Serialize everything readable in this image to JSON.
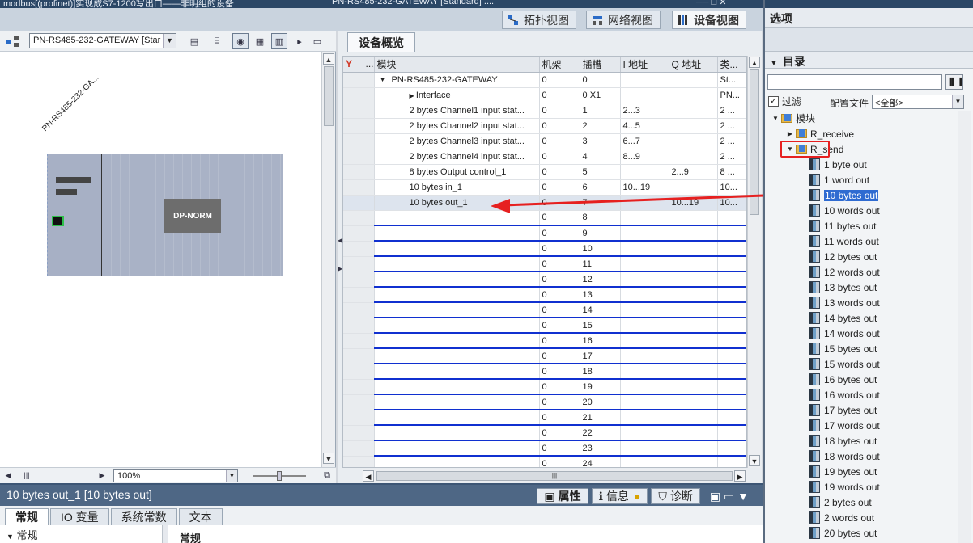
{
  "window": {
    "title_left": "modbus[(profinet)]实现成S7-1200写出口——非明组的设备",
    "title_mid": "PN-RS485-232-GATEWAY [Standard] ....",
    "title_right": "── □ ✕"
  },
  "view_tabs": [
    {
      "label": "拓扑视图",
      "icon": "topology-icon"
    },
    {
      "label": "网络视图",
      "icon": "network-icon"
    },
    {
      "label": "设备视图",
      "icon": "device-icon"
    }
  ],
  "device_toolbar": {
    "device_select": "PN-RS485-232-GATEWAY [Star",
    "zoom": "100%"
  },
  "device_graphic": {
    "device_label": "PN-RS485-232-GA...",
    "module_label": "DP-NORM"
  },
  "overview": {
    "tab": "设备概览",
    "headers": [
      "",
      "...",
      "模块",
      "机架",
      "插槽",
      "I 地址",
      "Q 地址",
      "类..."
    ],
    "rows": [
      {
        "module": "PN-RS485-232-GATEWAY",
        "rack": "0",
        "slot": "0",
        "i": "",
        "q": "",
        "type": "St...",
        "indent": 1,
        "expand": "▼"
      },
      {
        "module": "Interface",
        "rack": "0",
        "slot": "0 X1",
        "i": "",
        "q": "",
        "type": "PN...",
        "indent": 2,
        "expand": "▶"
      },
      {
        "module": "2 bytes Channel1 input stat...",
        "rack": "0",
        "slot": "1",
        "i": "2...3",
        "q": "",
        "type": "2 ...",
        "indent": 2,
        "expand": ""
      },
      {
        "module": "2 bytes Channel2 input stat...",
        "rack": "0",
        "slot": "2",
        "i": "4...5",
        "q": "",
        "type": "2 ...",
        "indent": 2,
        "expand": ""
      },
      {
        "module": "2 bytes Channel3 input stat...",
        "rack": "0",
        "slot": "3",
        "i": "6...7",
        "q": "",
        "type": "2 ...",
        "indent": 2,
        "expand": ""
      },
      {
        "module": "2 bytes Channel4 input stat...",
        "rack": "0",
        "slot": "4",
        "i": "8...9",
        "q": "",
        "type": "2 ...",
        "indent": 2,
        "expand": ""
      },
      {
        "module": "8 bytes Output control_1",
        "rack": "0",
        "slot": "5",
        "i": "",
        "q": "2...9",
        "type": "8 ...",
        "indent": 2,
        "expand": ""
      },
      {
        "module": "10 bytes in_1",
        "rack": "0",
        "slot": "6",
        "i": "10...19",
        "q": "",
        "type": "10...",
        "indent": 2,
        "expand": ""
      },
      {
        "module": "10 bytes out_1",
        "rack": "0",
        "slot": "7",
        "i": "",
        "q": "10...19",
        "type": "10...",
        "indent": 2,
        "expand": "",
        "selected": true
      },
      {
        "module": "",
        "rack": "0",
        "slot": "8",
        "i": "",
        "q": "",
        "type": "",
        "empty": true
      },
      {
        "module": "",
        "rack": "0",
        "slot": "9",
        "i": "",
        "q": "",
        "type": "",
        "empty": true
      },
      {
        "module": "",
        "rack": "0",
        "slot": "10",
        "i": "",
        "q": "",
        "type": "",
        "empty": true
      },
      {
        "module": "",
        "rack": "0",
        "slot": "11",
        "i": "",
        "q": "",
        "type": "",
        "empty": true
      },
      {
        "module": "",
        "rack": "0",
        "slot": "12",
        "i": "",
        "q": "",
        "type": "",
        "empty": true
      },
      {
        "module": "",
        "rack": "0",
        "slot": "13",
        "i": "",
        "q": "",
        "type": "",
        "empty": true
      },
      {
        "module": "",
        "rack": "0",
        "slot": "14",
        "i": "",
        "q": "",
        "type": "",
        "empty": true
      },
      {
        "module": "",
        "rack": "0",
        "slot": "15",
        "i": "",
        "q": "",
        "type": "",
        "empty": true
      },
      {
        "module": "",
        "rack": "0",
        "slot": "16",
        "i": "",
        "q": "",
        "type": "",
        "empty": true
      },
      {
        "module": "",
        "rack": "0",
        "slot": "17",
        "i": "",
        "q": "",
        "type": "",
        "empty": true
      },
      {
        "module": "",
        "rack": "0",
        "slot": "18",
        "i": "",
        "q": "",
        "type": "",
        "empty": true
      },
      {
        "module": "",
        "rack": "0",
        "slot": "19",
        "i": "",
        "q": "",
        "type": "",
        "empty": true
      },
      {
        "module": "",
        "rack": "0",
        "slot": "20",
        "i": "",
        "q": "",
        "type": "",
        "empty": true
      },
      {
        "module": "",
        "rack": "0",
        "slot": "21",
        "i": "",
        "q": "",
        "type": "",
        "empty": true
      },
      {
        "module": "",
        "rack": "0",
        "slot": "22",
        "i": "",
        "q": "",
        "type": "",
        "empty": true
      },
      {
        "module": "",
        "rack": "0",
        "slot": "23",
        "i": "",
        "q": "",
        "type": "",
        "empty": true
      },
      {
        "module": "",
        "rack": "0",
        "slot": "24",
        "i": "",
        "q": "",
        "type": "",
        "empty": true
      }
    ]
  },
  "right_panel": {
    "options_title": "选项",
    "catalog_title": "目录",
    "search_placeholder": "",
    "filter_label": "过滤",
    "profile_label": "配置文件",
    "profile_value": "<全部>",
    "tree": [
      {
        "label": "模块",
        "level": 0,
        "type": "folder",
        "expand": "▼"
      },
      {
        "label": "R_receive",
        "level": 1,
        "type": "folder",
        "expand": "▶"
      },
      {
        "label": "R_send",
        "level": 1,
        "type": "folder",
        "expand": "▼"
      },
      {
        "label": "1 byte out",
        "level": 2,
        "type": "module"
      },
      {
        "label": "1 word out",
        "level": 2,
        "type": "module"
      },
      {
        "label": "10 bytes out",
        "level": 2,
        "type": "module",
        "selected": true
      },
      {
        "label": "10 words out",
        "level": 2,
        "type": "module"
      },
      {
        "label": "11 bytes out",
        "level": 2,
        "type": "module"
      },
      {
        "label": "11 words out",
        "level": 2,
        "type": "module"
      },
      {
        "label": "12 bytes out",
        "level": 2,
        "type": "module"
      },
      {
        "label": "12 words out",
        "level": 2,
        "type": "module"
      },
      {
        "label": "13 bytes out",
        "level": 2,
        "type": "module"
      },
      {
        "label": "13 words out",
        "level": 2,
        "type": "module"
      },
      {
        "label": "14 bytes out",
        "level": 2,
        "type": "module"
      },
      {
        "label": "14 words out",
        "level": 2,
        "type": "module"
      },
      {
        "label": "15 bytes out",
        "level": 2,
        "type": "module"
      },
      {
        "label": "15 words out",
        "level": 2,
        "type": "module"
      },
      {
        "label": "16 bytes out",
        "level": 2,
        "type": "module"
      },
      {
        "label": "16 words out",
        "level": 2,
        "type": "module"
      },
      {
        "label": "17 bytes out",
        "level": 2,
        "type": "module"
      },
      {
        "label": "17 words out",
        "level": 2,
        "type": "module"
      },
      {
        "label": "18 bytes out",
        "level": 2,
        "type": "module"
      },
      {
        "label": "18 words out",
        "level": 2,
        "type": "module"
      },
      {
        "label": "19 bytes out",
        "level": 2,
        "type": "module"
      },
      {
        "label": "19 words out",
        "level": 2,
        "type": "module"
      },
      {
        "label": "2 bytes out",
        "level": 2,
        "type": "module"
      },
      {
        "label": "2 words out",
        "level": 2,
        "type": "module"
      },
      {
        "label": "20 bytes out",
        "level": 2,
        "type": "module"
      }
    ]
  },
  "inspector": {
    "title": "10 bytes out_1 [10 bytes out]",
    "right_tabs": [
      "属性",
      "信息",
      "诊断"
    ],
    "sub_tabs": [
      "常规",
      "IO 变量",
      "系统常数",
      "文本"
    ],
    "nav_item": "常规",
    "section_header": "常规"
  },
  "colors": {
    "accent": "#2f6bd1",
    "highlight_arrow": "#e62020",
    "empty_row_line": "#1030d0"
  }
}
